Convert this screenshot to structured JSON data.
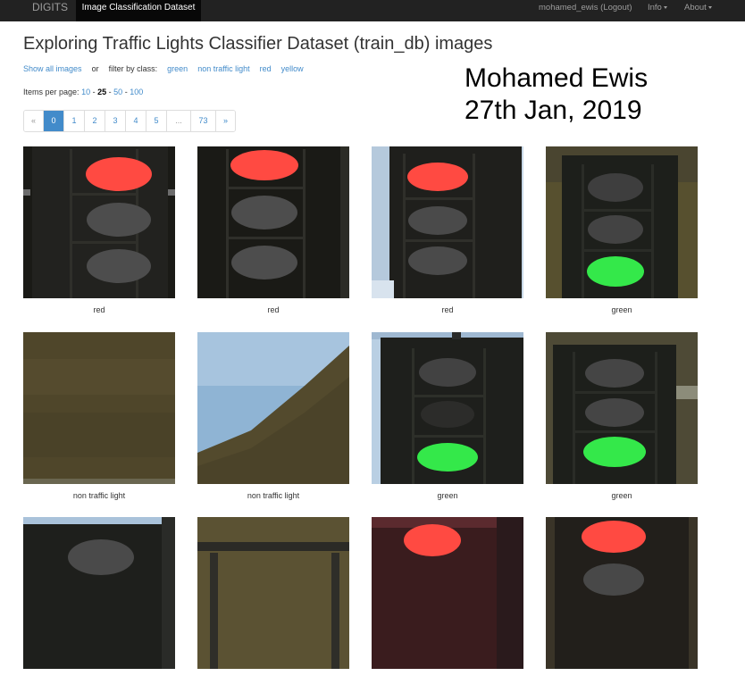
{
  "navbar": {
    "brand": "DIGITS",
    "active_tab": "Image Classification Dataset",
    "user_link": "mohamed_ewis (Logout)",
    "info_menu": "Info",
    "about_menu": "About"
  },
  "page": {
    "title": "Exploring Traffic Lights Classifier Dataset (train_db) images"
  },
  "filter": {
    "show_all": "Show all images",
    "or_text": "or",
    "filter_label": "filter by class:",
    "classes": [
      "green",
      "non traffic light",
      "red",
      "yellow"
    ]
  },
  "items_per_page": {
    "label": "Items per page:",
    "options": [
      "10",
      "25",
      "50",
      "100"
    ],
    "selected": "25",
    "separator": "-"
  },
  "pagination": {
    "items": [
      "«",
      "0",
      "1",
      "2",
      "3",
      "4",
      "5",
      "...",
      "73",
      "»"
    ],
    "active": "0"
  },
  "overlay": {
    "line1": "Mohamed Ewis",
    "line2": "27th Jan, 2019"
  },
  "images": [
    {
      "label": "red",
      "kind": "red-light"
    },
    {
      "label": "red",
      "kind": "red-light"
    },
    {
      "label": "red",
      "kind": "red-light-sky"
    },
    {
      "label": "green",
      "kind": "green-light"
    },
    {
      "label": "non traffic light",
      "kind": "ground"
    },
    {
      "label": "non traffic light",
      "kind": "sky-hill"
    },
    {
      "label": "green",
      "kind": "green-light-sky"
    },
    {
      "label": "green",
      "kind": "green-light"
    },
    {
      "label": "",
      "kind": "partial-light"
    },
    {
      "label": "",
      "kind": "partial-pole"
    },
    {
      "label": "",
      "kind": "partial-red"
    },
    {
      "label": "",
      "kind": "partial-red2"
    }
  ],
  "colors": {
    "navbar_bg": "#222222",
    "link": "#428bca",
    "lamp_red": "#ff4a42",
    "lamp_green": "#34e84a",
    "lamp_off": "#4d4d4d"
  }
}
